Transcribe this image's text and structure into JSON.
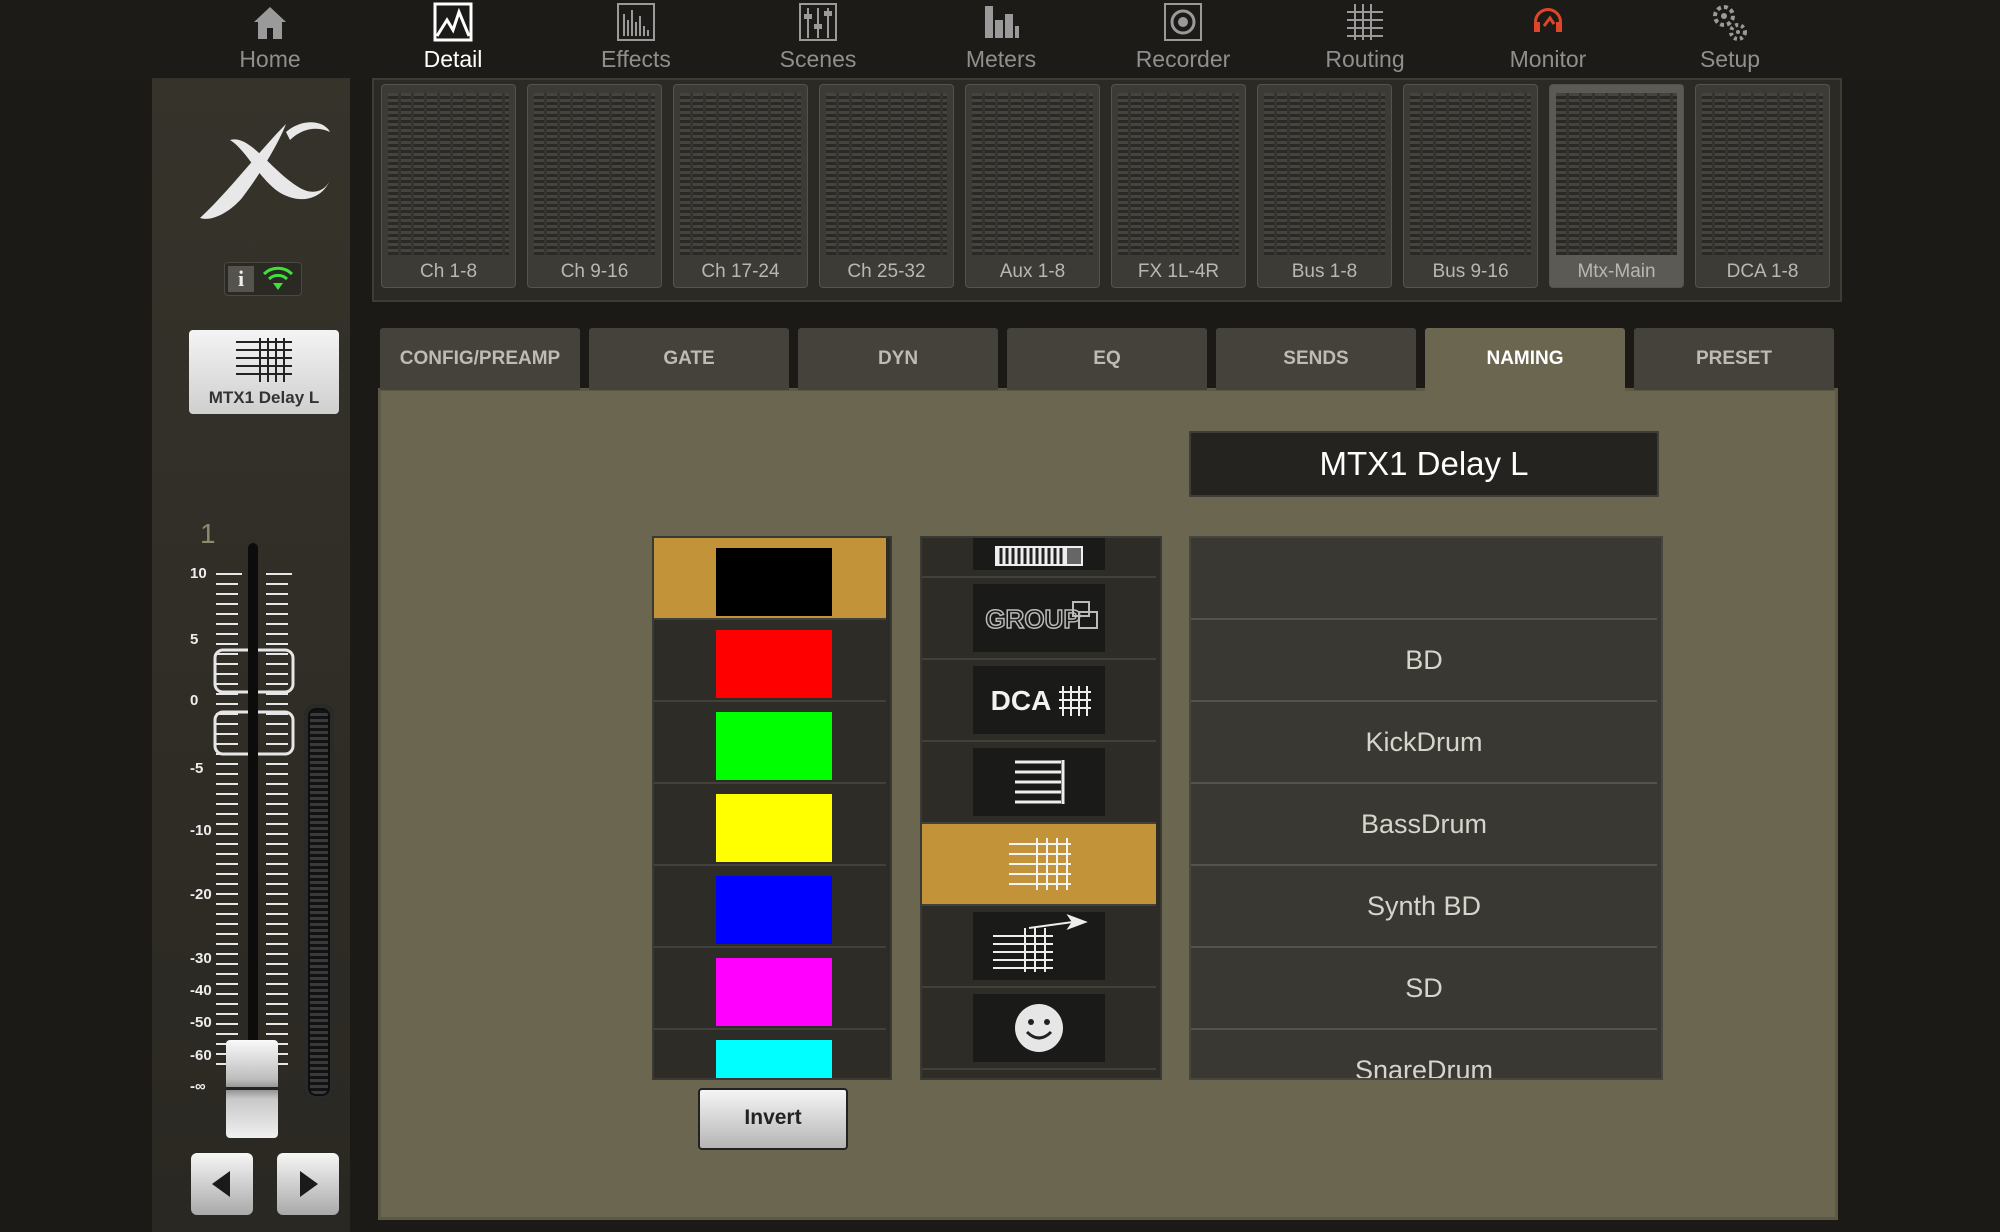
{
  "nav": {
    "items": [
      {
        "label": "Home",
        "icon": "home-icon"
      },
      {
        "label": "Detail",
        "icon": "detail-icon"
      },
      {
        "label": "Effects",
        "icon": "effects-icon"
      },
      {
        "label": "Scenes",
        "icon": "scenes-icon"
      },
      {
        "label": "Meters",
        "icon": "meters-icon"
      },
      {
        "label": "Recorder",
        "icon": "recorder-icon"
      },
      {
        "label": "Routing",
        "icon": "routing-icon"
      },
      {
        "label": "Monitor",
        "icon": "monitor-icon"
      },
      {
        "label": "Setup",
        "icon": "setup-icon"
      }
    ],
    "active": "Detail"
  },
  "banks": {
    "items": [
      "Ch 1-8",
      "Ch 9-16",
      "Ch 17-24",
      "Ch 25-32",
      "Aux 1-8",
      "FX 1L-4R",
      "Bus 1-8",
      "Bus 9-16",
      "Mtx-Main",
      "DCA 1-8"
    ],
    "active": "Mtx-Main"
  },
  "channel": {
    "name": "MTX1 Delay L",
    "number": "1",
    "icon": "matrix-icon"
  },
  "fader": {
    "scale": [
      "10",
      "5",
      "0",
      "-5",
      "-10",
      "-20",
      "-30",
      "-40",
      "-50",
      "-60",
      "-∞"
    ]
  },
  "tabs": {
    "items": [
      "CONFIG/PREAMP",
      "GATE",
      "DYN",
      "EQ",
      "SENDS",
      "NAMING",
      "PRESET"
    ],
    "active": "NAMING"
  },
  "naming": {
    "name_value": "MTX1 Delay L",
    "colors": [
      {
        "name": "black",
        "hex": "#000000",
        "selected": true
      },
      {
        "name": "red",
        "hex": "#ff0000"
      },
      {
        "name": "green",
        "hex": "#00ff00"
      },
      {
        "name": "yellow",
        "hex": "#ffff00"
      },
      {
        "name": "blue",
        "hex": "#0000ff"
      },
      {
        "name": "magenta",
        "hex": "#ff00ff"
      },
      {
        "name": "cyan",
        "hex": "#00ffff"
      }
    ],
    "invert_label": "Invert",
    "icons": [
      {
        "name": "keyboard-icon"
      },
      {
        "name": "group-icon",
        "text": "GROUP"
      },
      {
        "name": "dca-icon",
        "text": "DCA"
      },
      {
        "name": "bus-icon"
      },
      {
        "name": "matrix-icon",
        "selected": true
      },
      {
        "name": "matrix-send-icon"
      },
      {
        "name": "smiley-icon"
      }
    ],
    "preset_names": [
      "",
      "BD",
      "KickDrum",
      "BassDrum",
      "Synth BD",
      "SD",
      "SnareDrum"
    ]
  },
  "colors": {
    "accent": "#c39339",
    "panel": "#6b6650",
    "monitor_icon": "#e0452a"
  }
}
